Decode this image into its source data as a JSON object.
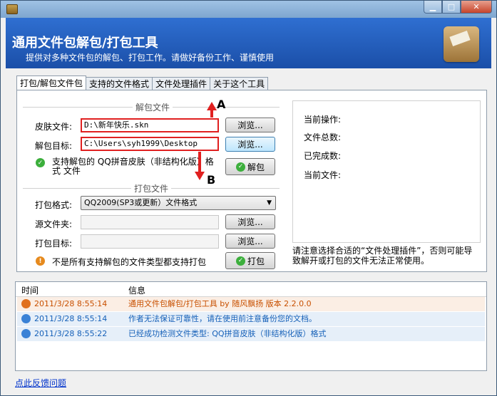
{
  "window": {
    "title_buttons": {
      "minimize": "▁",
      "maximize": "□",
      "close": "✕"
    }
  },
  "header": {
    "title": "通用文件包解包/打包工具",
    "subtitle": "提供对多种文件包的解包、打包工作。请做好备份工作、谨慎使用"
  },
  "tabs": [
    {
      "label": "打包/解包文件包",
      "active": true
    },
    {
      "label": "支持的文件格式",
      "active": false
    },
    {
      "label": "文件处理插件",
      "active": false
    },
    {
      "label": "关于这个工具",
      "active": false
    }
  ],
  "unpack": {
    "group_title": "解包文件",
    "skin_label": "皮肤文件:",
    "skin_value": "D:\\新年快乐.skn",
    "target_label": "解包目标:",
    "target_value": "C:\\Users\\syh1999\\Desktop",
    "browse_label": "浏览...",
    "support_text": "支持解包的 QQ拼音皮肤（非结构化版）格式 文件",
    "action_label": "解包"
  },
  "pack": {
    "group_title": "打包文件",
    "format_label": "打包格式:",
    "format_value": "QQ2009(SP3或更新）文件格式",
    "source_label": "源文件夹:",
    "target_label": "打包目标:",
    "browse_label": "浏览...",
    "warning_text": "不是所有支持解包的文件类型都支持打包",
    "action_label": "打包"
  },
  "status": {
    "current_op": "当前操作:",
    "file_total": "文件总数:",
    "completed": "已完成数:",
    "current_file": "当前文件:",
    "note": "请注意选择合适的“文件处理插件”，否则可能导致解开或打包的文件无法正常使用。"
  },
  "log": {
    "col_time": "时间",
    "col_info": "信息",
    "rows": [
      {
        "time": "2011/3/28 8:55:14",
        "msg": "通用文件包解包/打包工具 by 随风飘扬 版本 2.2.0.0",
        "color": "#c85000",
        "bg": "#fbeee4",
        "icon": "heart-icon"
      },
      {
        "time": "2011/3/28 8:55:14",
        "msg": "作者无法保证可靠性，请在使用前注意备份您的文档。",
        "color": "#1560b8",
        "bg": "#e6eff9",
        "icon": "info-icon"
      },
      {
        "time": "2011/3/28 8:55:22",
        "msg": "已经成功检测文件类型: QQ拼音皮肤（非结构化版）格式",
        "color": "#1560b8",
        "bg": "#e6eff9",
        "icon": "info-icon"
      }
    ]
  },
  "feedback_link": "点此反馈问题",
  "annotations": {
    "a": "A",
    "b": "B"
  },
  "colors": {
    "header_bg": "#1f5bb8",
    "highlight_border": "#e02020",
    "log_orange": "#c85000",
    "log_blue": "#1560b8"
  }
}
